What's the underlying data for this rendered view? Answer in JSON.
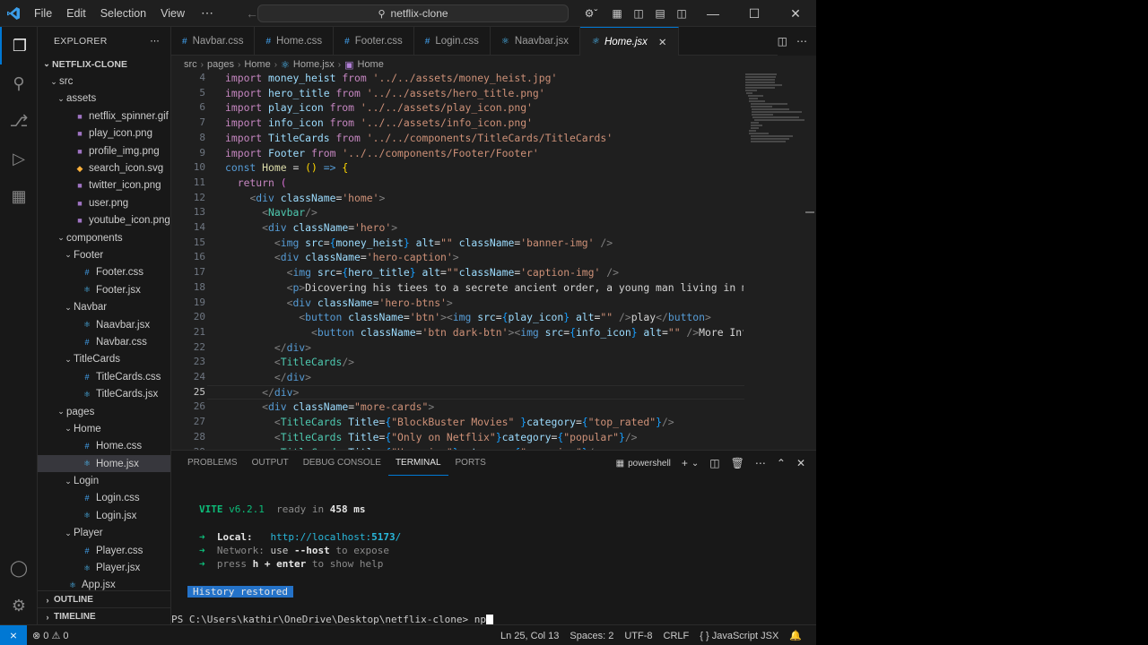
{
  "titlebar": {
    "menus": [
      "File",
      "Edit",
      "Selection",
      "View"
    ],
    "more": "⋯",
    "search_text": "netflix-clone"
  },
  "sidebar": {
    "title": "EXPLORER",
    "more": "⋯",
    "tree": [
      {
        "label": "NETFLIX-CLONE",
        "depth": 0,
        "chev": "⌄",
        "icon": "",
        "root": true
      },
      {
        "label": "src",
        "depth": 1,
        "chev": "⌄",
        "icon": ""
      },
      {
        "label": "assets",
        "depth": 2,
        "chev": "⌄",
        "icon": ""
      },
      {
        "label": "netflix_spinner.gif",
        "depth": 3,
        "chev": "",
        "icon": "■",
        "color": "#a074c4"
      },
      {
        "label": "play_icon.png",
        "depth": 3,
        "chev": "",
        "icon": "■",
        "color": "#a074c4"
      },
      {
        "label": "profile_img.png",
        "depth": 3,
        "chev": "",
        "icon": "■",
        "color": "#a074c4"
      },
      {
        "label": "search_icon.svg",
        "depth": 3,
        "chev": "",
        "icon": "◆",
        "color": "#ffb13b"
      },
      {
        "label": "twitter_icon.png",
        "depth": 3,
        "chev": "",
        "icon": "■",
        "color": "#a074c4"
      },
      {
        "label": "user.png",
        "depth": 3,
        "chev": "",
        "icon": "■",
        "color": "#a074c4"
      },
      {
        "label": "youtube_icon.png",
        "depth": 3,
        "chev": "",
        "icon": "■",
        "color": "#a074c4"
      },
      {
        "label": "components",
        "depth": 2,
        "chev": "⌄",
        "icon": ""
      },
      {
        "label": "Footer",
        "depth": 3,
        "chev": "⌄",
        "icon": ""
      },
      {
        "label": "Footer.css",
        "depth": 4,
        "chev": "",
        "icon": "#",
        "color": "#42a5f5"
      },
      {
        "label": "Footer.jsx",
        "depth": 4,
        "chev": "",
        "icon": "⚛",
        "color": "#4fc1ff"
      },
      {
        "label": "Navbar",
        "depth": 3,
        "chev": "⌄",
        "icon": ""
      },
      {
        "label": "Naavbar.jsx",
        "depth": 4,
        "chev": "",
        "icon": "⚛",
        "color": "#4fc1ff"
      },
      {
        "label": "Navbar.css",
        "depth": 4,
        "chev": "",
        "icon": "#",
        "color": "#42a5f5"
      },
      {
        "label": "TitleCards",
        "depth": 3,
        "chev": "⌄",
        "icon": ""
      },
      {
        "label": "TitleCards.css",
        "depth": 4,
        "chev": "",
        "icon": "#",
        "color": "#42a5f5"
      },
      {
        "label": "TitleCards.jsx",
        "depth": 4,
        "chev": "",
        "icon": "⚛",
        "color": "#4fc1ff"
      },
      {
        "label": "pages",
        "depth": 2,
        "chev": "⌄",
        "icon": ""
      },
      {
        "label": "Home",
        "depth": 3,
        "chev": "⌄",
        "icon": ""
      },
      {
        "label": "Home.css",
        "depth": 4,
        "chev": "",
        "icon": "#",
        "color": "#42a5f5"
      },
      {
        "label": "Home.jsx",
        "depth": 4,
        "chev": "",
        "icon": "⚛",
        "color": "#4fc1ff",
        "selected": true
      },
      {
        "label": "Login",
        "depth": 3,
        "chev": "⌄",
        "icon": ""
      },
      {
        "label": "Login.css",
        "depth": 4,
        "chev": "",
        "icon": "#",
        "color": "#42a5f5"
      },
      {
        "label": "Login.jsx",
        "depth": 4,
        "chev": "",
        "icon": "⚛",
        "color": "#4fc1ff"
      },
      {
        "label": "Player",
        "depth": 3,
        "chev": "⌄",
        "icon": ""
      },
      {
        "label": "Player.css",
        "depth": 4,
        "chev": "",
        "icon": "#",
        "color": "#42a5f5"
      },
      {
        "label": "Player.jsx",
        "depth": 4,
        "chev": "",
        "icon": "⚛",
        "color": "#4fc1ff"
      },
      {
        "label": "App.jsx",
        "depth": 2,
        "chev": "",
        "icon": "⚛",
        "color": "#4fc1ff"
      }
    ],
    "outline": "OUTLINE",
    "timeline": "TIMELINE"
  },
  "tabs": [
    {
      "label": "Navbar.css",
      "icon": "#",
      "color": "#42a5f5"
    },
    {
      "label": "Home.css",
      "icon": "#",
      "color": "#42a5f5"
    },
    {
      "label": "Footer.css",
      "icon": "#",
      "color": "#42a5f5"
    },
    {
      "label": "Login.css",
      "icon": "#",
      "color": "#42a5f5"
    },
    {
      "label": "Naavbar.jsx",
      "icon": "⚛",
      "color": "#4fc1ff"
    },
    {
      "label": "Home.jsx",
      "icon": "⚛",
      "color": "#4fc1ff",
      "active": true
    }
  ],
  "breadcrumb": [
    "src",
    "pages",
    "Home",
    "Home.jsx",
    "Home"
  ],
  "editor": {
    "first_line": 4,
    "current_line": 25,
    "lines": [
      [
        [
          "k",
          "import "
        ],
        [
          "v",
          "money_heist "
        ],
        [
          "k",
          "from "
        ],
        [
          "s",
          "'../../assets/money_heist.jpg'"
        ]
      ],
      [
        [
          "k",
          "import "
        ],
        [
          "v",
          "hero_title "
        ],
        [
          "k",
          "from "
        ],
        [
          "s",
          "'../../assets/hero_title.png'"
        ]
      ],
      [
        [
          "k",
          "import "
        ],
        [
          "v",
          "play_icon "
        ],
        [
          "k",
          "from "
        ],
        [
          "s",
          "'../../assets/play_icon.png'"
        ]
      ],
      [
        [
          "k",
          "import "
        ],
        [
          "v",
          "info_icon "
        ],
        [
          "k",
          "from "
        ],
        [
          "s",
          "'../../assets/info_icon.png'"
        ]
      ],
      [
        [
          "k",
          "import "
        ],
        [
          "v",
          "TitleCards "
        ],
        [
          "k",
          "from "
        ],
        [
          "s",
          "'../../components/TitleCards/TitleCards'"
        ]
      ],
      [
        [
          "k",
          "import "
        ],
        [
          "v",
          "Footer "
        ],
        [
          "k",
          "from "
        ],
        [
          "s",
          "'../../components/Footer/Footer'"
        ]
      ],
      [
        [
          "kb",
          "const "
        ],
        [
          "f",
          "Home "
        ],
        [
          "w",
          "= "
        ],
        [
          "by",
          "()"
        ],
        [
          "w",
          " "
        ],
        [
          "kb",
          "=>"
        ],
        [
          "w",
          " "
        ],
        [
          "by",
          "{"
        ]
      ],
      [
        [
          "w",
          "  "
        ],
        [
          "k",
          "return "
        ],
        [
          "br",
          "("
        ]
      ],
      [
        [
          "w",
          "    "
        ],
        [
          "p",
          "<"
        ],
        [
          "tg",
          "div "
        ],
        [
          "v",
          "className"
        ],
        [
          "w",
          "="
        ],
        [
          "s",
          "'home'"
        ],
        [
          "p",
          ">"
        ]
      ],
      [
        [
          "w",
          "      "
        ],
        [
          "p",
          "<"
        ],
        [
          "t",
          "Navbar"
        ],
        [
          "p",
          "/>"
        ]
      ],
      [
        [
          "w",
          "      "
        ],
        [
          "p",
          "<"
        ],
        [
          "tg",
          "div "
        ],
        [
          "v",
          "className"
        ],
        [
          "w",
          "="
        ],
        [
          "s",
          "'hero'"
        ],
        [
          "p",
          ">"
        ]
      ],
      [
        [
          "w",
          "        "
        ],
        [
          "p",
          "<"
        ],
        [
          "tg",
          "img "
        ],
        [
          "v",
          "src"
        ],
        [
          "w",
          "="
        ],
        [
          "bb",
          "{"
        ],
        [
          "v",
          "money_heist"
        ],
        [
          "bb",
          "}"
        ],
        [
          "w",
          " "
        ],
        [
          "v",
          "alt"
        ],
        [
          "w",
          "="
        ],
        [
          "s",
          "\"\""
        ],
        [
          "w",
          " "
        ],
        [
          "v",
          "className"
        ],
        [
          "w",
          "="
        ],
        [
          "s",
          "'banner-img'"
        ],
        [
          "w",
          " "
        ],
        [
          "p",
          "/>"
        ]
      ],
      [
        [
          "w",
          "        "
        ],
        [
          "p",
          "<"
        ],
        [
          "tg",
          "div "
        ],
        [
          "v",
          "className"
        ],
        [
          "w",
          "="
        ],
        [
          "s",
          "'hero-caption'"
        ],
        [
          "p",
          ">"
        ]
      ],
      [
        [
          "w",
          "          "
        ],
        [
          "p",
          "<"
        ],
        [
          "tg",
          "img "
        ],
        [
          "v",
          "src"
        ],
        [
          "w",
          "="
        ],
        [
          "bb",
          "{"
        ],
        [
          "v",
          "hero_title"
        ],
        [
          "bb",
          "}"
        ],
        [
          "w",
          " "
        ],
        [
          "v",
          "alt"
        ],
        [
          "w",
          "="
        ],
        [
          "s",
          "\"\""
        ],
        [
          "v",
          "className"
        ],
        [
          "w",
          "="
        ],
        [
          "s",
          "'caption-img'"
        ],
        [
          "w",
          " "
        ],
        [
          "p",
          "/>"
        ]
      ],
      [
        [
          "w",
          "          "
        ],
        [
          "p",
          "<"
        ],
        [
          "tg",
          "p"
        ],
        [
          "p",
          ">"
        ],
        [
          "w",
          "Dicovering his tiees to a secrete ancient order, a young man living in mo"
        ]
      ],
      [
        [
          "w",
          "          "
        ],
        [
          "p",
          "<"
        ],
        [
          "tg",
          "div "
        ],
        [
          "v",
          "className"
        ],
        [
          "w",
          "="
        ],
        [
          "s",
          "'hero-btns'"
        ],
        [
          "p",
          ">"
        ]
      ],
      [
        [
          "w",
          "            "
        ],
        [
          "p",
          "<"
        ],
        [
          "tg",
          "button "
        ],
        [
          "v",
          "className"
        ],
        [
          "w",
          "="
        ],
        [
          "s",
          "'btn'"
        ],
        [
          "p",
          "><"
        ],
        [
          "tg",
          "img "
        ],
        [
          "v",
          "src"
        ],
        [
          "w",
          "="
        ],
        [
          "bb",
          "{"
        ],
        [
          "v",
          "play_icon"
        ],
        [
          "bb",
          "}"
        ],
        [
          "w",
          " "
        ],
        [
          "v",
          "alt"
        ],
        [
          "w",
          "="
        ],
        [
          "s",
          "\"\""
        ],
        [
          "w",
          " "
        ],
        [
          "p",
          "/>"
        ],
        [
          "w",
          "play"
        ],
        [
          "p",
          "</"
        ],
        [
          "tg",
          "button"
        ],
        [
          "p",
          ">"
        ]
      ],
      [
        [
          "w",
          "              "
        ],
        [
          "p",
          "<"
        ],
        [
          "tg",
          "button "
        ],
        [
          "v",
          "className"
        ],
        [
          "w",
          "="
        ],
        [
          "s",
          "'btn dark-btn'"
        ],
        [
          "p",
          "><"
        ],
        [
          "tg",
          "img "
        ],
        [
          "v",
          "src"
        ],
        [
          "w",
          "="
        ],
        [
          "bb",
          "{"
        ],
        [
          "v",
          "info_icon"
        ],
        [
          "bb",
          "}"
        ],
        [
          "w",
          " "
        ],
        [
          "v",
          "alt"
        ],
        [
          "w",
          "="
        ],
        [
          "s",
          "\"\""
        ],
        [
          "w",
          " "
        ],
        [
          "p",
          "/>"
        ],
        [
          "w",
          "More Info"
        ]
      ],
      [
        [
          "w",
          "        "
        ],
        [
          "p",
          "</"
        ],
        [
          "tg",
          "div"
        ],
        [
          "p",
          ">"
        ]
      ],
      [
        [
          "w",
          "        "
        ],
        [
          "p",
          "<"
        ],
        [
          "t",
          "TitleCards"
        ],
        [
          "p",
          "/>"
        ]
      ],
      [
        [
          "w",
          "        "
        ],
        [
          "p",
          "</"
        ],
        [
          "tg",
          "div"
        ],
        [
          "p",
          ">"
        ]
      ],
      [
        [
          "w",
          "      "
        ],
        [
          "p",
          "</"
        ],
        [
          "tg",
          "div"
        ],
        [
          "p",
          ">"
        ]
      ],
      [
        [
          "w",
          "      "
        ],
        [
          "p",
          "<"
        ],
        [
          "tg",
          "div "
        ],
        [
          "v",
          "className"
        ],
        [
          "w",
          "="
        ],
        [
          "s",
          "\"more-cards\""
        ],
        [
          "p",
          ">"
        ]
      ],
      [
        [
          "w",
          "        "
        ],
        [
          "p",
          "<"
        ],
        [
          "t",
          "TitleCards "
        ],
        [
          "v",
          "Title"
        ],
        [
          "w",
          "="
        ],
        [
          "bb",
          "{"
        ],
        [
          "s",
          "\"BlockBuster Movies\""
        ],
        [
          "w",
          " "
        ],
        [
          "bb",
          "}"
        ],
        [
          "v",
          "category"
        ],
        [
          "w",
          "="
        ],
        [
          "bb",
          "{"
        ],
        [
          "s",
          "\"top_rated\""
        ],
        [
          "bb",
          "}"
        ],
        [
          "p",
          "/>"
        ]
      ],
      [
        [
          "w",
          "        "
        ],
        [
          "p",
          "<"
        ],
        [
          "t",
          "TitleCards "
        ],
        [
          "v",
          "Title"
        ],
        [
          "w",
          "="
        ],
        [
          "bb",
          "{"
        ],
        [
          "s",
          "\"Only on Netflix\""
        ],
        [
          "bb",
          "}"
        ],
        [
          "v",
          "category"
        ],
        [
          "w",
          "="
        ],
        [
          "bb",
          "{"
        ],
        [
          "s",
          "\"popular\""
        ],
        [
          "bb",
          "}"
        ],
        [
          "p",
          "/>"
        ]
      ],
      [
        [
          "w",
          "        "
        ],
        [
          "p",
          "<"
        ],
        [
          "t",
          "TitleCards "
        ],
        [
          "v",
          "Title"
        ],
        [
          "w",
          "="
        ],
        [
          "bb",
          "{"
        ],
        [
          "s",
          "\"Upcoming\""
        ],
        [
          "bb",
          "}"
        ],
        [
          "v",
          "category"
        ],
        [
          "w",
          "="
        ],
        [
          "bb",
          "{"
        ],
        [
          "s",
          "\"upcoming\""
        ],
        [
          "bb",
          "}"
        ],
        [
          "p",
          "/>"
        ]
      ]
    ]
  },
  "panel": {
    "tabs": [
      "PROBLEMS",
      "OUTPUT",
      "DEBUG CONSOLE",
      "TERMINAL",
      "PORTS"
    ],
    "active_tab": "TERMINAL",
    "shell": "powershell",
    "terminal": {
      "vite_name": "VITE",
      "vite_version": "v6.2.1",
      "ready_text": "ready in",
      "ready_ms": "458 ms",
      "arrow": "➜",
      "local_label": "Local:",
      "local_url_base": "http://localhost:",
      "local_port": "5173",
      "local_url_end": "/",
      "network_label": "Network:",
      "network_use": "use",
      "network_flag": "--host",
      "network_rest": "to expose",
      "help_press": "press",
      "help_key": "h + enter",
      "help_rest": "to show help",
      "history": "History restored",
      "prompt": "PS C:\\Users\\kathir\\OneDrive\\Desktop\\netflix-clone>",
      "input": "np"
    }
  },
  "statusbar": {
    "remote": "⨯",
    "problems": "⊗ 0 ⚠ 0",
    "position": "Ln 25, Col 13",
    "spaces": "Spaces: 2",
    "encoding": "UTF-8",
    "eol": "CRLF",
    "language": "{ } JavaScript JSX",
    "bell": "🔔"
  }
}
